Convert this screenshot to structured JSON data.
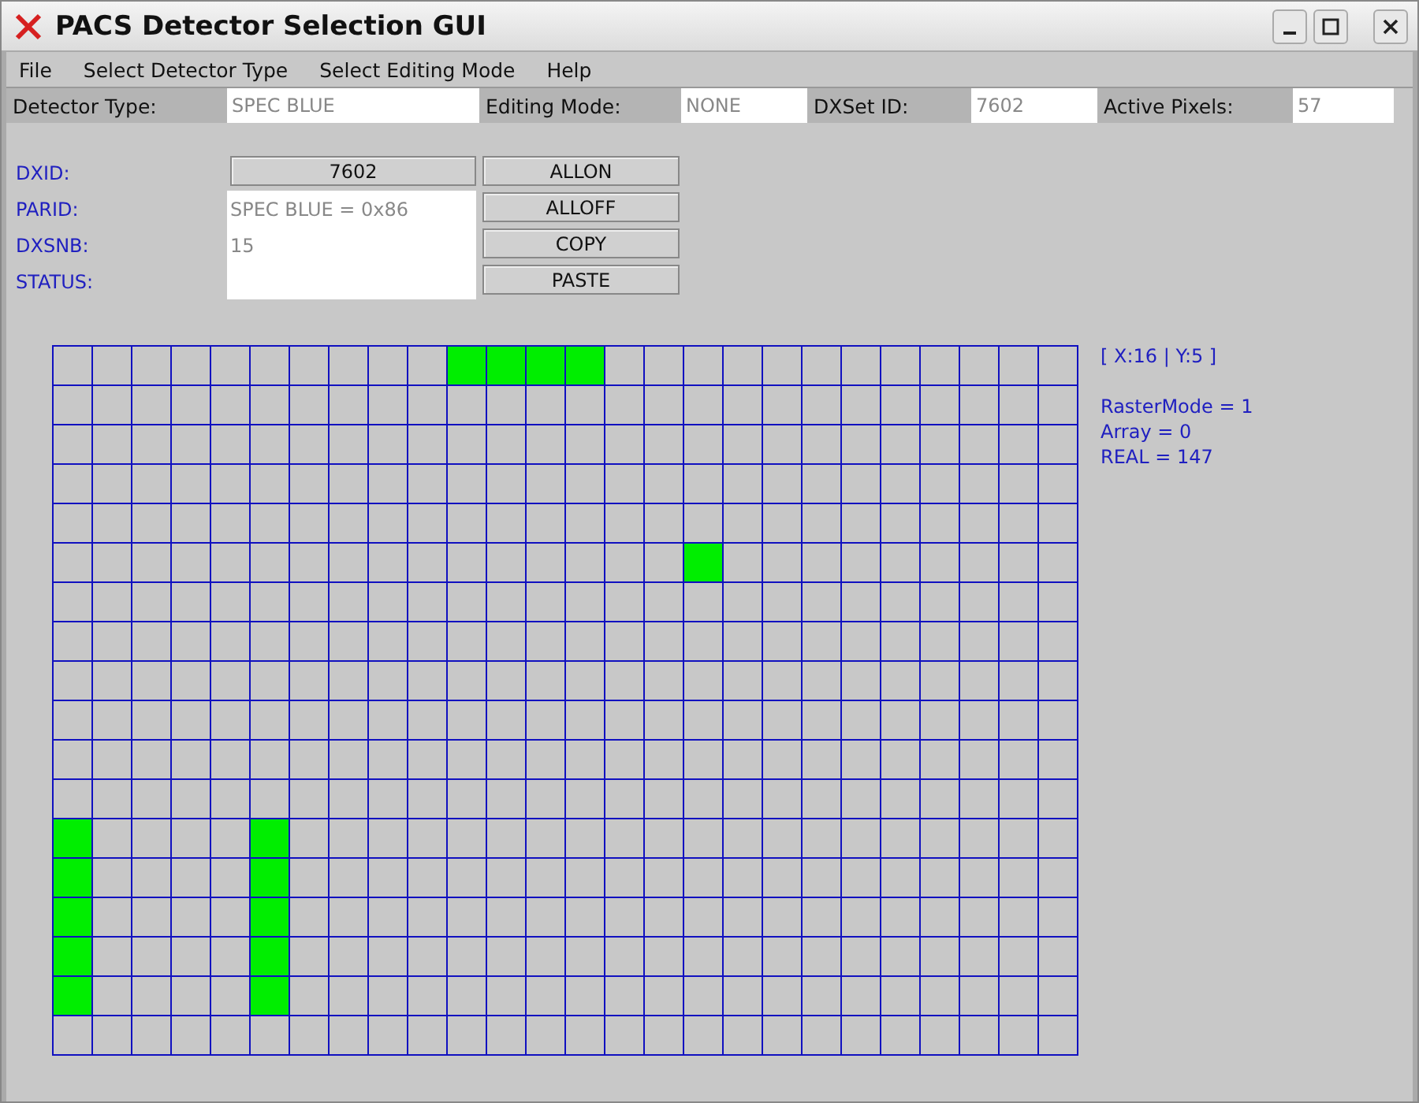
{
  "window": {
    "title": "PACS Detector Selection GUI"
  },
  "menu": [
    "File",
    "Select Detector Type",
    "Select Editing Mode",
    "Help"
  ],
  "info_bar": [
    {
      "label": "Detector Type:",
      "value": "SPEC BLUE"
    },
    {
      "label": "Editing Mode:",
      "value": "NONE"
    },
    {
      "label": "DXSet ID:",
      "value": "7602"
    },
    {
      "label": "Active Pixels:",
      "value": "57"
    }
  ],
  "form": {
    "labels": [
      "DXID:",
      "PARID:",
      "DXSNB:",
      "STATUS:"
    ],
    "dxid_button": "7602",
    "details": [
      "SPEC BLUE = 0x86",
      "15"
    ]
  },
  "actions": [
    "ALLON",
    "ALLOFF",
    "COPY",
    "PASTE"
  ],
  "grid": {
    "rows": [
      [
        false,
        false,
        false,
        false,
        false,
        false,
        false,
        false,
        false,
        false,
        true,
        true,
        true,
        true,
        false,
        false,
        false,
        false,
        false,
        false,
        false,
        false,
        false,
        false,
        false,
        false
      ],
      [
        false,
        false,
        false,
        false,
        false,
        false,
        false,
        false,
        false,
        false,
        false,
        false,
        false,
        false,
        false,
        false,
        false,
        false,
        false,
        false,
        false,
        false,
        false,
        false,
        false,
        false
      ],
      [
        false,
        false,
        false,
        false,
        false,
        false,
        false,
        false,
        false,
        false,
        false,
        false,
        false,
        false,
        false,
        false,
        false,
        false,
        false,
        false,
        false,
        false,
        false,
        false,
        false,
        false
      ],
      [
        false,
        false,
        false,
        false,
        false,
        false,
        false,
        false,
        false,
        false,
        false,
        false,
        false,
        false,
        false,
        false,
        false,
        false,
        false,
        false,
        false,
        false,
        false,
        false,
        false,
        false
      ],
      [
        false,
        false,
        false,
        false,
        false,
        false,
        false,
        false,
        false,
        false,
        false,
        false,
        false,
        false,
        false,
        false,
        false,
        false,
        false,
        false,
        false,
        false,
        false,
        false,
        false,
        false
      ],
      [
        false,
        false,
        false,
        false,
        false,
        false,
        false,
        false,
        false,
        false,
        false,
        false,
        false,
        false,
        false,
        false,
        true,
        false,
        false,
        false,
        false,
        false,
        false,
        false,
        false,
        false
      ],
      [
        false,
        false,
        false,
        false,
        false,
        false,
        false,
        false,
        false,
        false,
        false,
        false,
        false,
        false,
        false,
        false,
        false,
        false,
        false,
        false,
        false,
        false,
        false,
        false,
        false,
        false
      ],
      [
        false,
        false,
        false,
        false,
        false,
        false,
        false,
        false,
        false,
        false,
        false,
        false,
        false,
        false,
        false,
        false,
        false,
        false,
        false,
        false,
        false,
        false,
        false,
        false,
        false,
        false
      ],
      [
        false,
        false,
        false,
        false,
        false,
        false,
        false,
        false,
        false,
        false,
        false,
        false,
        false,
        false,
        false,
        false,
        false,
        false,
        false,
        false,
        false,
        false,
        false,
        false,
        false,
        false
      ],
      [
        false,
        false,
        false,
        false,
        false,
        false,
        false,
        false,
        false,
        false,
        false,
        false,
        false,
        false,
        false,
        false,
        false,
        false,
        false,
        false,
        false,
        false,
        false,
        false,
        false,
        false
      ],
      [
        false,
        false,
        false,
        false,
        false,
        false,
        false,
        false,
        false,
        false,
        false,
        false,
        false,
        false,
        false,
        false,
        false,
        false,
        false,
        false,
        false,
        false,
        false,
        false,
        false,
        false
      ],
      [
        false,
        false,
        false,
        false,
        false,
        false,
        false,
        false,
        false,
        false,
        false,
        false,
        false,
        false,
        false,
        false,
        false,
        false,
        false,
        false,
        false,
        false,
        false,
        false,
        false,
        false
      ],
      [
        true,
        false,
        false,
        false,
        false,
        true,
        false,
        false,
        false,
        false,
        false,
        false,
        false,
        false,
        false,
        false,
        false,
        false,
        false,
        false,
        false,
        false,
        false,
        false,
        false,
        false
      ],
      [
        true,
        false,
        false,
        false,
        false,
        true,
        false,
        false,
        false,
        false,
        false,
        false,
        false,
        false,
        false,
        false,
        false,
        false,
        false,
        false,
        false,
        false,
        false,
        false,
        false,
        false
      ],
      [
        true,
        false,
        false,
        false,
        false,
        true,
        false,
        false,
        false,
        false,
        false,
        false,
        false,
        false,
        false,
        false,
        false,
        false,
        false,
        false,
        false,
        false,
        false,
        false,
        false,
        false
      ],
      [
        true,
        false,
        false,
        false,
        false,
        true,
        false,
        false,
        false,
        false,
        false,
        false,
        false,
        false,
        false,
        false,
        false,
        false,
        false,
        false,
        false,
        false,
        false,
        false,
        false,
        false
      ],
      [
        true,
        false,
        false,
        false,
        false,
        true,
        false,
        false,
        false,
        false,
        false,
        false,
        false,
        false,
        false,
        false,
        false,
        false,
        false,
        false,
        false,
        false,
        false,
        false,
        false,
        false
      ],
      [
        false,
        false,
        false,
        false,
        false,
        false,
        false,
        false,
        false,
        false,
        false,
        false,
        false,
        false,
        false,
        false,
        false,
        false,
        false,
        false,
        false,
        false,
        false,
        false,
        false,
        false
      ]
    ]
  },
  "side_info": {
    "cursor": "[ X:16 | Y:5 ]",
    "lines": [
      "RasterMode = 1",
      "Array = 0",
      "REAL = 147"
    ]
  }
}
